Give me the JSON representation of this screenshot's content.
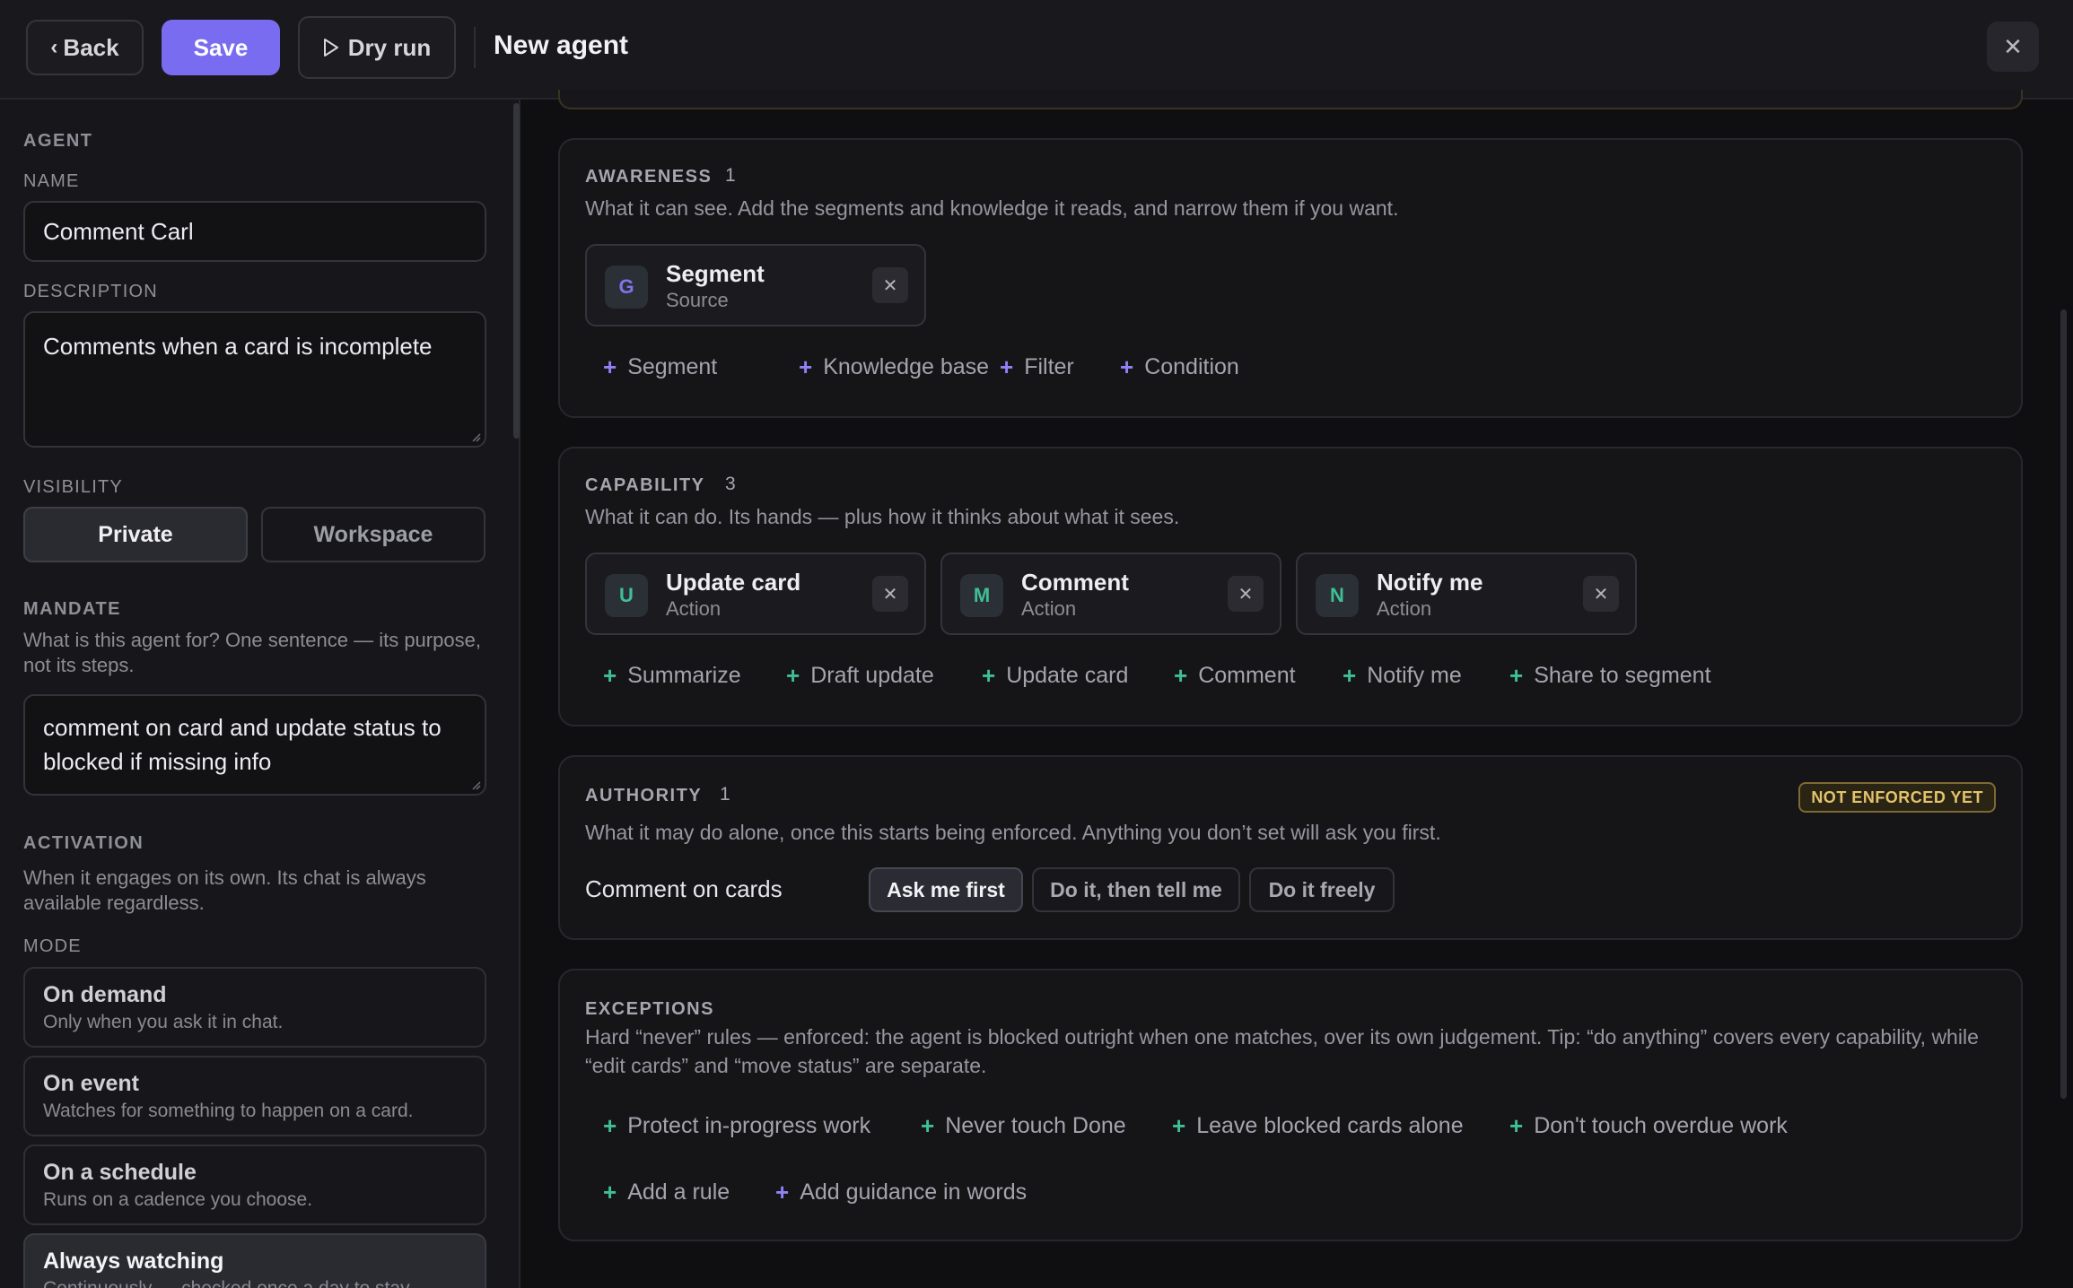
{
  "header": {
    "back_label": "Back",
    "save_label": "Save",
    "dry_run_label": "Dry run",
    "title": "New agent"
  },
  "sidebar": {
    "agent_caption": "AGENT",
    "name_label": "NAME",
    "name_value": "Comment Carl",
    "description_label": "DESCRIPTION",
    "description_value": "Comments when a card is incomplete",
    "visibility_label": "VISIBILITY",
    "visibility_options": [
      "Private",
      "Workspace"
    ],
    "visibility_selected": "Private",
    "mandate_caption": "MANDATE",
    "mandate_help": "What is this agent for? One sentence — its purpose, not its steps.",
    "mandate_value": "comment on card and update status to blocked if missing info",
    "activation_caption": "ACTIVATION",
    "activation_help": "When it engages on its own. Its chat is always available regardless.",
    "mode_label": "MODE",
    "modes": [
      {
        "title": "On demand",
        "subtitle": "Only when you ask it in chat."
      },
      {
        "title": "On event",
        "subtitle": "Watches for something to happen on a card."
      },
      {
        "title": "On a schedule",
        "subtitle": "Runs on a cadence you choose."
      },
      {
        "title": "Always watching",
        "subtitle": "Continuously — checked once a day to stay"
      }
    ],
    "mode_selected": "Always watching"
  },
  "awareness": {
    "title": "AWARENESS",
    "count": "1",
    "description": "What it can see. Add the segments and knowledge it reads, and narrow them if you want.",
    "items": [
      {
        "avatar": "G",
        "name": "Segment",
        "type": "Source",
        "avatar_color": "#7f74e8"
      }
    ],
    "add_options": [
      "Segment",
      "Knowledge base",
      "Filter",
      "Condition"
    ]
  },
  "capability": {
    "title": "CAPABILITY",
    "count": "3",
    "description": "What it can do. Its hands — plus how it thinks about what it sees.",
    "items": [
      {
        "avatar": "U",
        "name": "Update card",
        "type": "Action",
        "avatar_color": "#3fbf94"
      },
      {
        "avatar": "M",
        "name": "Comment",
        "type": "Action",
        "avatar_color": "#3fbf94"
      },
      {
        "avatar": "N",
        "name": "Notify me",
        "type": "Action",
        "avatar_color": "#3fbf94"
      }
    ],
    "add_options": [
      "Summarize",
      "Draft update",
      "Update card",
      "Comment",
      "Notify me",
      "Share to segment"
    ]
  },
  "authority": {
    "title": "AUTHORITY",
    "count": "1",
    "badge": "NOT ENFORCED YET",
    "description": "What it may do alone, once this starts being enforced. Anything you don’t set will ask you first.",
    "rule_label": "Comment on cards",
    "options": [
      "Ask me first",
      "Do it, then tell me",
      "Do it freely"
    ],
    "selected": "Ask me first"
  },
  "exceptions": {
    "title": "EXCEPTIONS",
    "description": "Hard “never” rules — enforced: the agent is blocked outright when one matches, over its own judgement. Tip: “do anything” covers every capability, while “edit cards” and “move status” are separate.",
    "suggestions": [
      "Protect in-progress work",
      "Never touch Done",
      "Leave blocked cards alone",
      "Don't touch overdue work"
    ],
    "actions": [
      "Add a rule",
      "Add guidance in words"
    ]
  },
  "colors": {
    "accent": "#7a6cf0",
    "action_green": "#3fbf94",
    "warning": "#e4c46b"
  }
}
